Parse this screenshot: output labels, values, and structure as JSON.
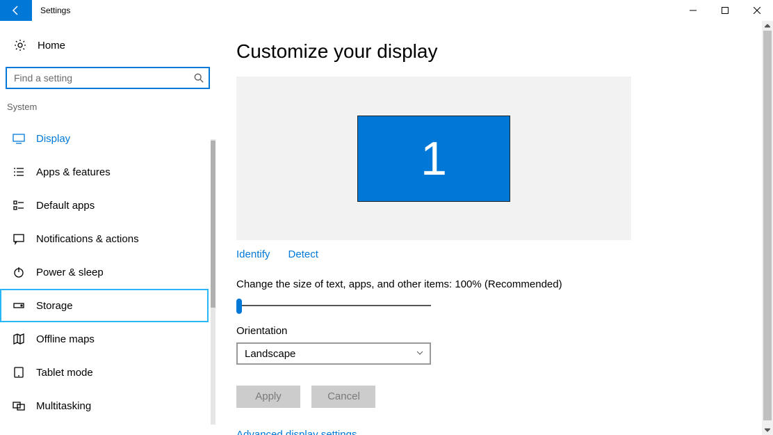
{
  "window": {
    "title": "Settings"
  },
  "sidebar": {
    "home": "Home",
    "search_placeholder": "Find a setting",
    "category": "System",
    "items": [
      {
        "label": "Display"
      },
      {
        "label": "Apps & features"
      },
      {
        "label": "Default apps"
      },
      {
        "label": "Notifications & actions"
      },
      {
        "label": "Power & sleep"
      },
      {
        "label": "Storage"
      },
      {
        "label": "Offline maps"
      },
      {
        "label": "Tablet mode"
      },
      {
        "label": "Multitasking"
      }
    ]
  },
  "main": {
    "title": "Customize your display",
    "monitor_number": "1",
    "identify": "Identify",
    "detect": "Detect",
    "size_label": "Change the size of text, apps, and other items: 100% (Recommended)",
    "orientation_label": "Orientation",
    "orientation_value": "Landscape",
    "apply": "Apply",
    "cancel": "Cancel",
    "advanced": "Advanced display settings"
  }
}
